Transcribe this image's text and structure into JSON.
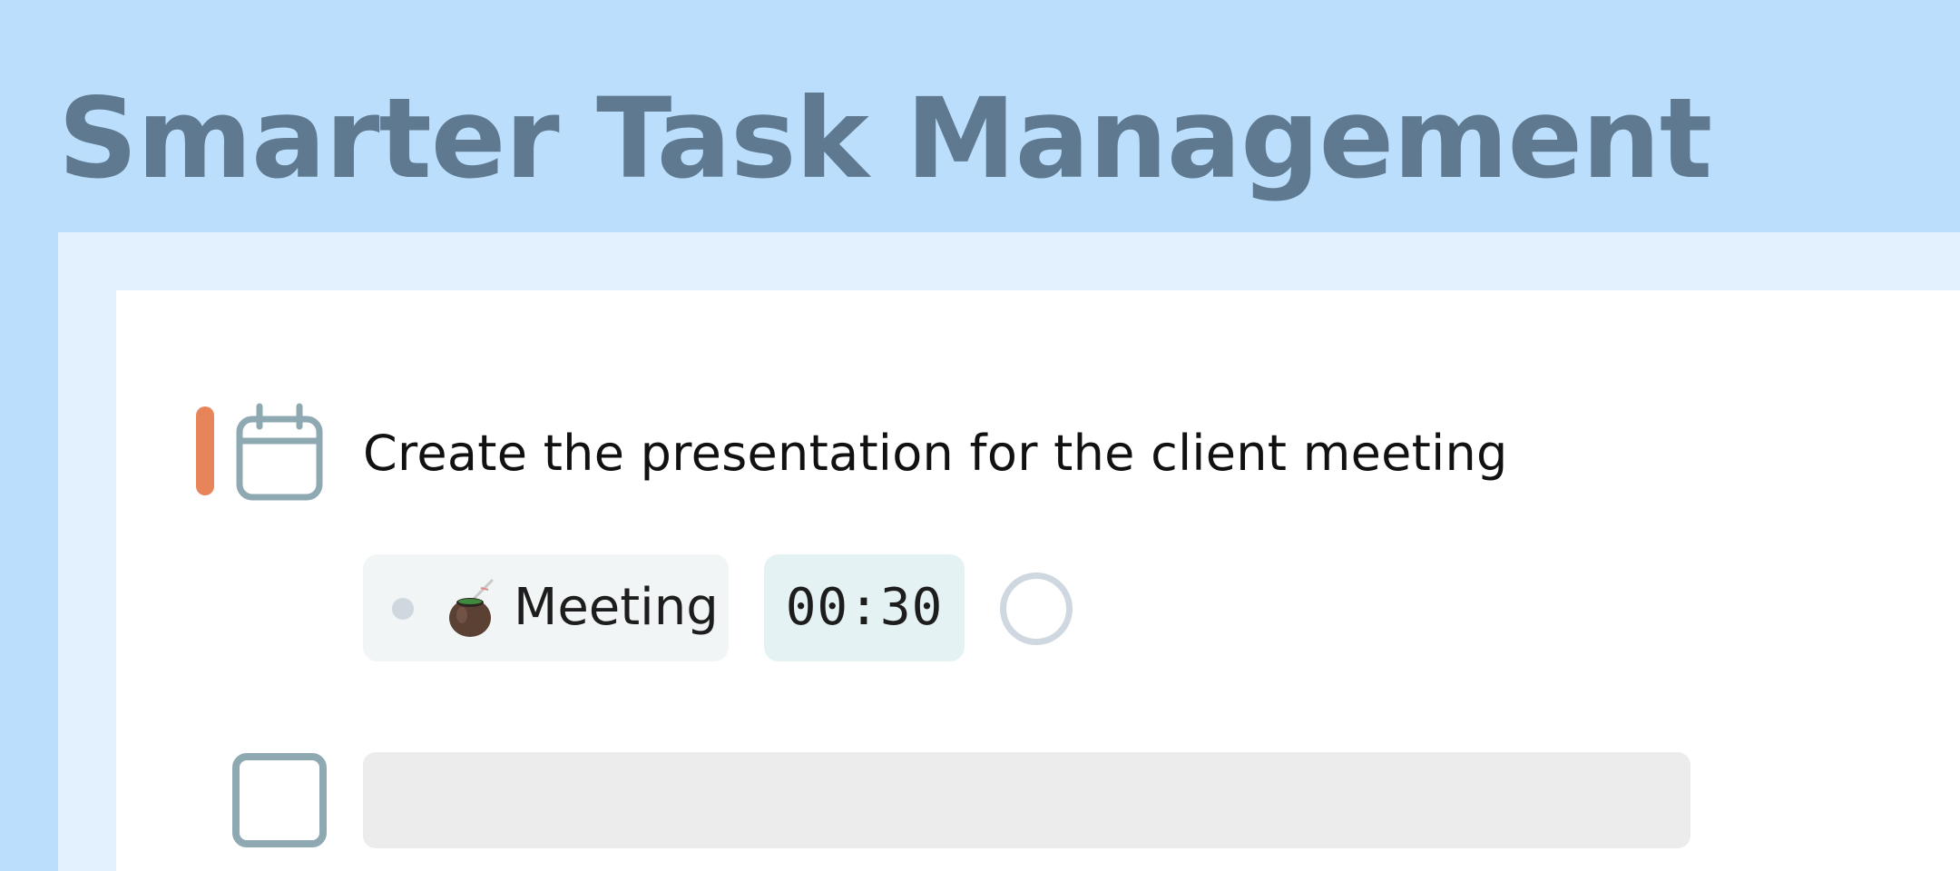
{
  "header": {
    "title": "Smarter Task Management"
  },
  "task": {
    "title": "Create the presentation for the client meeting",
    "priority_color": "#e8845a",
    "icon": "calendar-icon",
    "category": {
      "emoji_icon": "mate-gourd-icon",
      "label": "Meeting"
    },
    "duration": "00:30"
  },
  "new_task": {
    "placeholder": ""
  },
  "colors": {
    "background": "#bbdefc",
    "title": "#5f7a90",
    "frame": "#e3f1fe",
    "card": "#ffffff",
    "icon_stroke": "#8fa9b2"
  }
}
